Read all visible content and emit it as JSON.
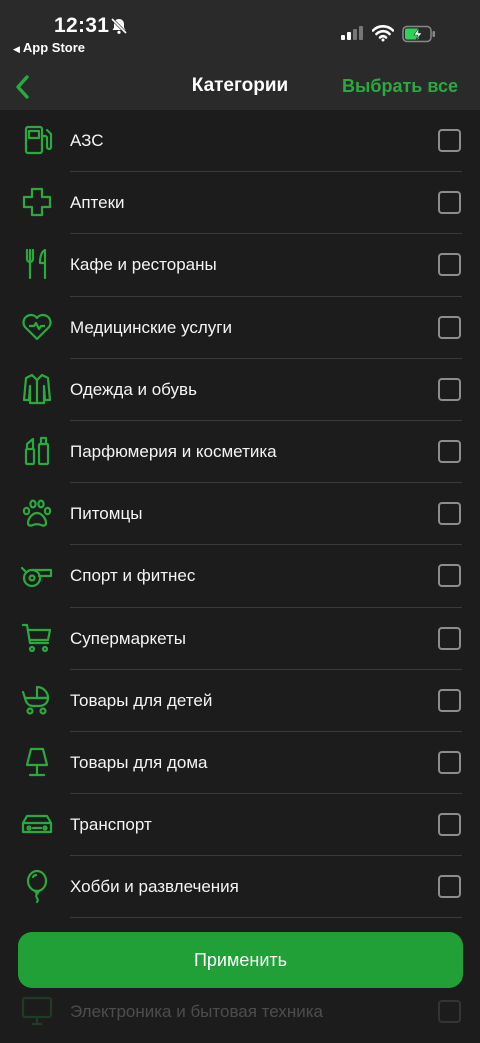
{
  "status_bar": {
    "time": "12:31",
    "back_app": "App Store"
  },
  "nav": {
    "title": "Категории",
    "select_all": "Выбрать все"
  },
  "colors": {
    "accent": "#2aaa3e",
    "button": "#21a038",
    "background": "#1c1c1c",
    "header": "#2a2a2a"
  },
  "categories": [
    {
      "label": "АЗС",
      "icon": "fuel-pump-icon",
      "checked": false
    },
    {
      "label": "Аптеки",
      "icon": "pharmacy-cross-icon",
      "checked": false
    },
    {
      "label": "Кафе и рестораны",
      "icon": "fork-knife-icon",
      "checked": false
    },
    {
      "label": "Медицинские услуги",
      "icon": "heart-icon",
      "checked": false
    },
    {
      "label": "Одежда и обувь",
      "icon": "coat-icon",
      "checked": false
    },
    {
      "label": "Парфюмерия и косметика",
      "icon": "cosmetics-icon",
      "checked": false
    },
    {
      "label": "Питомцы",
      "icon": "paw-icon",
      "checked": false
    },
    {
      "label": "Спорт и фитнес",
      "icon": "whistle-icon",
      "checked": false
    },
    {
      "label": "Супермаркеты",
      "icon": "shopping-cart-icon",
      "checked": false
    },
    {
      "label": "Товары для детей",
      "icon": "stroller-icon",
      "checked": false
    },
    {
      "label": "Товары для дома",
      "icon": "lamp-icon",
      "checked": false
    },
    {
      "label": "Транспорт",
      "icon": "car-icon",
      "checked": false
    },
    {
      "label": "Хобби и развлечения",
      "icon": "balloon-icon",
      "checked": false
    },
    {
      "label": "",
      "icon": "",
      "checked": false
    },
    {
      "label": "Электроника и бытовая техника",
      "icon": "monitor-icon",
      "checked": false
    }
  ],
  "apply_button": {
    "label": "Применить"
  }
}
